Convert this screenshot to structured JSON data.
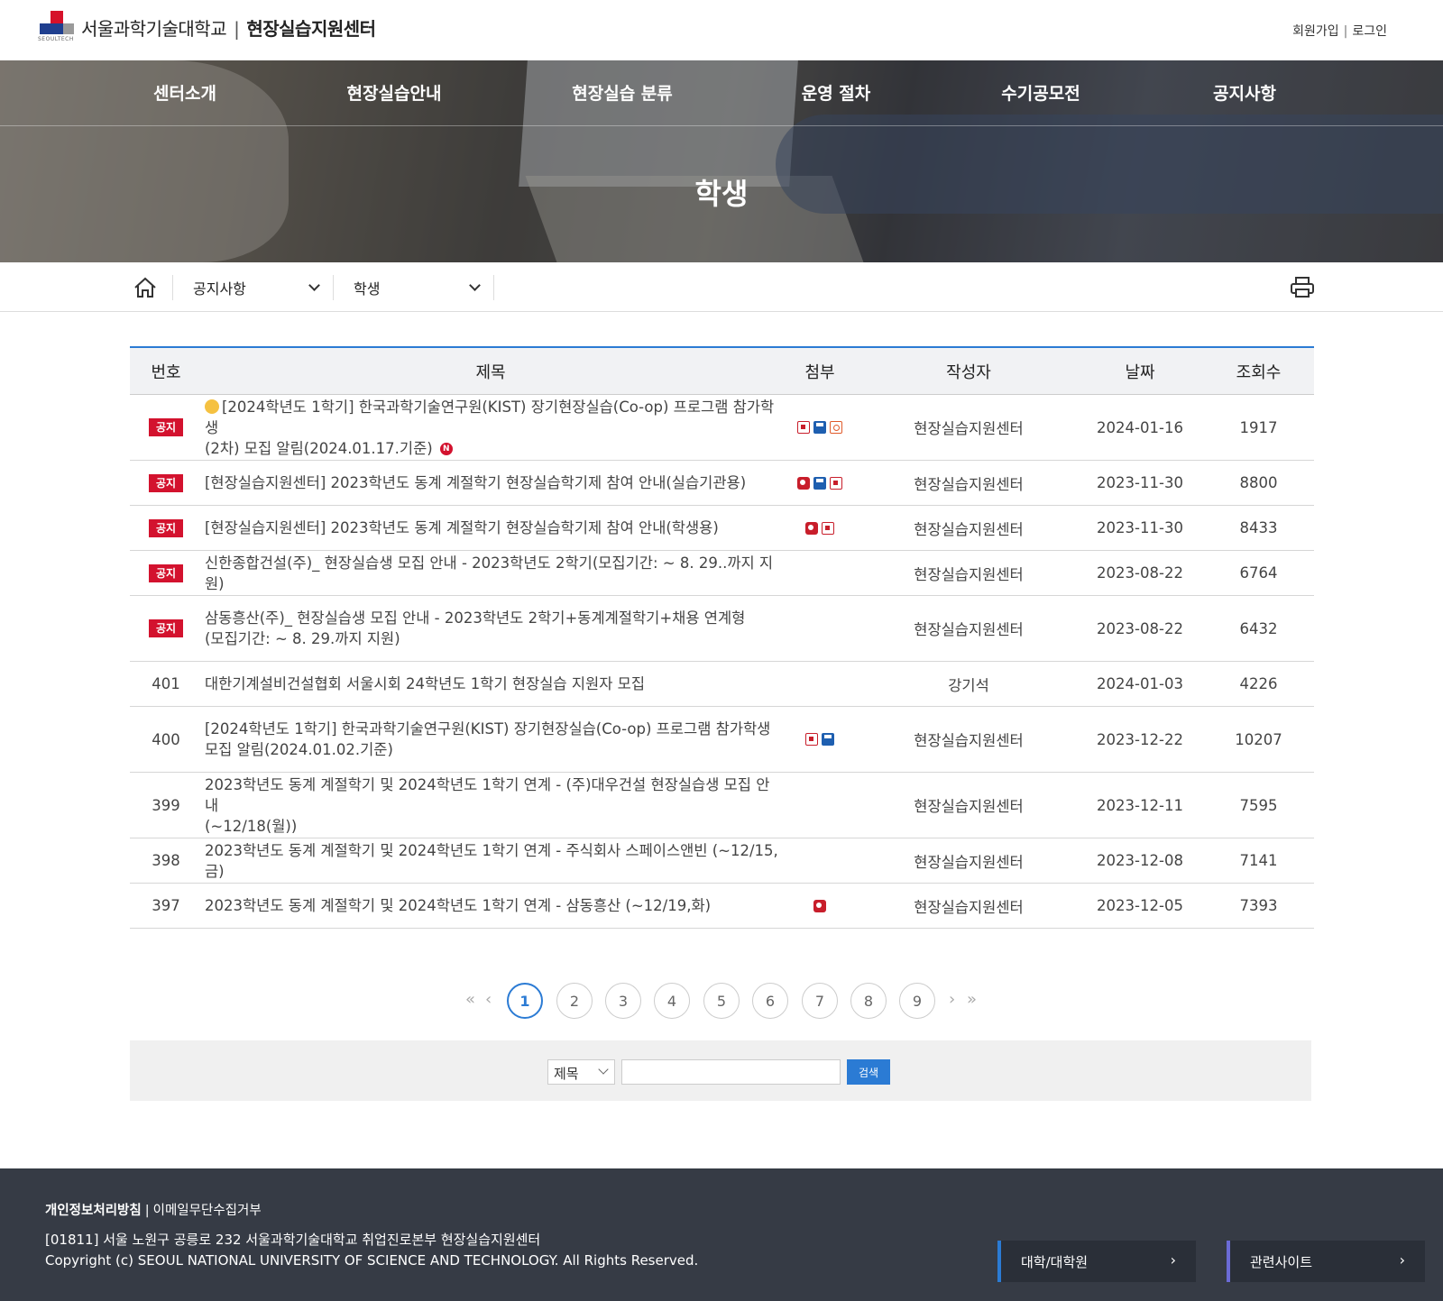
{
  "header": {
    "logo_sub": "SEOULTECH",
    "university": "서울과학기술대학교",
    "separator": "|",
    "center": "현장실습지원센터",
    "signup": "회원가입",
    "auth_sep": "|",
    "login": "로그인"
  },
  "nav": [
    "센터소개",
    "현장실습안내",
    "현장실습 분류",
    "운영 절차",
    "수기공모전",
    "공지사항"
  ],
  "hero": {
    "title": "학생"
  },
  "location": {
    "level1": "공지사항",
    "level2": "학생"
  },
  "table": {
    "headers": {
      "no": "번호",
      "title": "제목",
      "attach": "첨부",
      "writer": "작성자",
      "date": "날짜",
      "hits": "조회수"
    },
    "notice_label": "공지",
    "new_label": "N",
    "rows": [
      {
        "no": "공지",
        "notice": true,
        "emoji": true,
        "title1": "[2024학년도 1학기] 한국과학기술연구원(KIST) 장기현장실습(Co-op) 프로그램 참가학생",
        "title2": "(2차) 모집 알림(2024.01.17.기준)",
        "new": true,
        "files": [
          "pdf",
          "disk",
          "img"
        ],
        "writer": "현장실습지원센터",
        "date": "2024-01-16",
        "hits": "1917"
      },
      {
        "no": "공지",
        "notice": true,
        "title1": "[현장실습지원센터] 2023학년도 동계 계절학기 현장실습학기제 참여 안내(실습기관용)",
        "title2": "",
        "files": [
          "hwp",
          "disk",
          "pdf"
        ],
        "writer": "현장실습지원센터",
        "date": "2023-11-30",
        "hits": "8800"
      },
      {
        "no": "공지",
        "notice": true,
        "title1": "[현장실습지원센터] 2023학년도 동계 계절학기 현장실습학기제 참여 안내(학생용)",
        "title2": "",
        "files": [
          "hwp",
          "pdf"
        ],
        "writer": "현장실습지원센터",
        "date": "2023-11-30",
        "hits": "8433"
      },
      {
        "no": "공지",
        "notice": true,
        "title1": "신한종합건설(주)_ 현장실습생 모집 안내 - 2023학년도 2학기(모집기간: ~ 8. 29..까지 지원)",
        "title2": "",
        "files": [],
        "writer": "현장실습지원센터",
        "date": "2023-08-22",
        "hits": "6764"
      },
      {
        "no": "공지",
        "notice": true,
        "title1": "삼동흥산(주)_ 현장실습생 모집 안내 - 2023학년도 2학기+동계계절학기+채용 연계형",
        "title2": "(모집기간: ~ 8. 29.까지 지원)",
        "files": [],
        "writer": "현장실습지원센터",
        "date": "2023-08-22",
        "hits": "6432"
      },
      {
        "no": "401",
        "notice": false,
        "title1": "대한기계설비건설협회 서울시회 24학년도 1학기 현장실습 지원자 모집",
        "title2": "",
        "files": [],
        "writer": "강기석",
        "date": "2024-01-03",
        "hits": "4226"
      },
      {
        "no": "400",
        "notice": false,
        "title1": "[2024학년도 1학기] 한국과학기술연구원(KIST) 장기현장실습(Co-op) 프로그램 참가학생",
        "title2": "모집 알림(2024.01.02.기준)",
        "files": [
          "pdf",
          "disk"
        ],
        "writer": "현장실습지원센터",
        "date": "2023-12-22",
        "hits": "10207"
      },
      {
        "no": "399",
        "notice": false,
        "title1": "2023학년도 동계 계절학기 및 2024학년도 1학기 연계 - (주)대우건설 현장실습생 모집 안내",
        "title2": "(~12/18(월))",
        "files": [],
        "writer": "현장실습지원센터",
        "date": "2023-12-11",
        "hits": "7595"
      },
      {
        "no": "398",
        "notice": false,
        "title1": "2023학년도 동계 계절학기 및 2024학년도 1학기 연계 - 주식회사 스페이스앤빈 (~12/15, 금)",
        "title2": "",
        "files": [],
        "writer": "현장실습지원센터",
        "date": "2023-12-08",
        "hits": "7141"
      },
      {
        "no": "397",
        "notice": false,
        "title1": "2023학년도 동계 계절학기 및 2024학년도 1학기 연계 - 삼동흥산 (~12/19,화)",
        "title2": "",
        "files": [
          "hwp"
        ],
        "writer": "현장실습지원센터",
        "date": "2023-12-05",
        "hits": "7393"
      }
    ]
  },
  "pagination": {
    "first": "«",
    "prev": "‹",
    "pages": [
      "1",
      "2",
      "3",
      "4",
      "5",
      "6",
      "7",
      "8",
      "9"
    ],
    "current": "1",
    "next": "›",
    "last": "»"
  },
  "search": {
    "field": "제목",
    "value": "",
    "button": "검색"
  },
  "footer": {
    "privacy": "개인정보처리방침",
    "sep": "|",
    "email": "이메일무단수집거부",
    "address": "[01811] 서울 노원구 공릉로 232 서울과학기술대학교 취업진로본부 현장실습지원센터",
    "copyright": "Copyright (c) SEOUL NATIONAL UNIVERSITY OF SCIENCE AND TECHNOLOGY. All Rights Reserved.",
    "btn1": "대학/대학원",
    "btn2": "관련사이트",
    "arrow": "›"
  },
  "colors": {
    "accent": "#2b7bd4",
    "notice": "#d3122e",
    "footer_bg": "#363b45"
  },
  "icons": {
    "home": "home-icon",
    "print": "printer-icon",
    "files": [
      "pdf-icon",
      "hwp-icon",
      "disk-icon",
      "image-icon"
    ]
  }
}
